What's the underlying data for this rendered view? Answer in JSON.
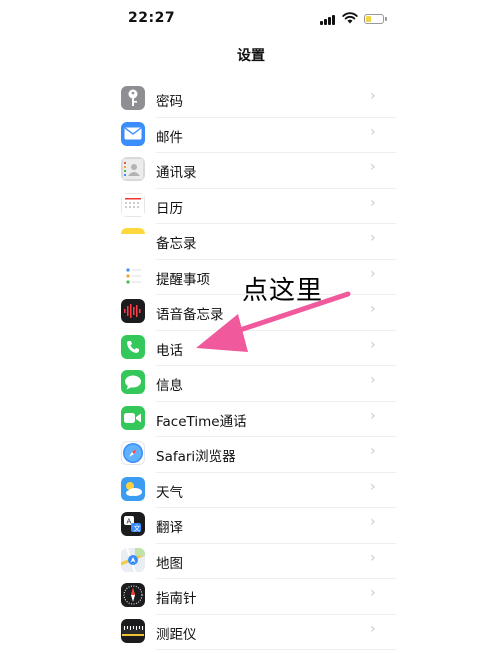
{
  "status_bar": {
    "time": "22:27"
  },
  "nav": {
    "title": "设置"
  },
  "items": [
    {
      "label": "密码",
      "icon": "key-icon",
      "color": "#8e8e93"
    },
    {
      "label": "邮件",
      "icon": "mail-icon",
      "color": "#3a8dfb"
    },
    {
      "label": "通讯录",
      "icon": "contacts-icon",
      "color": "#d9d9d9"
    },
    {
      "label": "日历",
      "icon": "calendar-icon",
      "color": "#ffffff"
    },
    {
      "label": "备忘录",
      "icon": "notes-icon",
      "color": "#ffd93b"
    },
    {
      "label": "提醒事项",
      "icon": "reminders-icon",
      "color": "#ffffff"
    },
    {
      "label": "语音备忘录",
      "icon": "voice-memos-icon",
      "color": "#1c1c1e"
    },
    {
      "label": "电话",
      "icon": "phone-icon",
      "color": "#34c759"
    },
    {
      "label": "信息",
      "icon": "messages-icon",
      "color": "#34c759"
    },
    {
      "label": "FaceTime通话",
      "icon": "facetime-icon",
      "color": "#34c759"
    },
    {
      "label": "Safari浏览器",
      "icon": "safari-icon",
      "color": "#ffffff"
    },
    {
      "label": "天气",
      "icon": "weather-icon",
      "color": "#3b9cf2"
    },
    {
      "label": "翻译",
      "icon": "translate-icon",
      "color": "#1c1c1e"
    },
    {
      "label": "地图",
      "icon": "maps-icon",
      "color": "#e8eef3"
    },
    {
      "label": "指南针",
      "icon": "compass-icon",
      "color": "#1c1c1e"
    },
    {
      "label": "测距仪",
      "icon": "measure-icon",
      "color": "#1c1c1e"
    }
  ],
  "annotation": {
    "text": "点这里",
    "arrow_color": "#f05a9c"
  }
}
